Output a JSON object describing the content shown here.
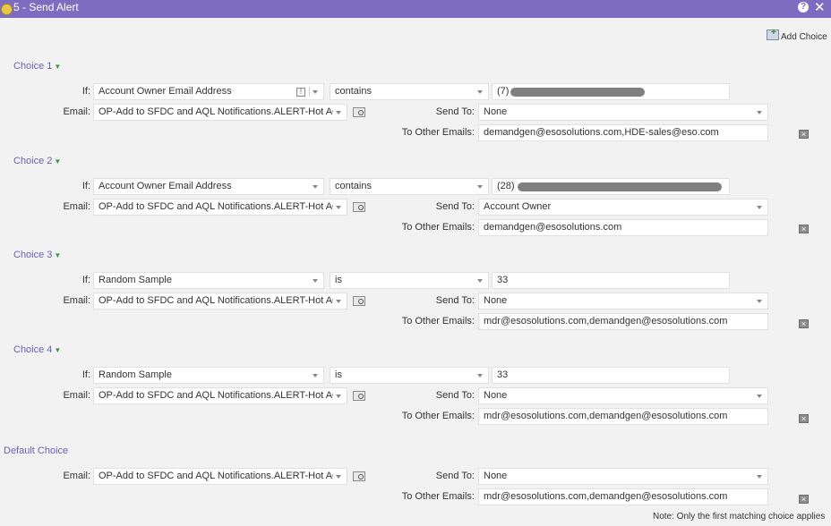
{
  "title": "5 - Send Alert",
  "add_choice_label": "Add Choice",
  "labels": {
    "if": "If:",
    "email": "Email:",
    "send_to": "Send To:",
    "to_other_emails": "To Other Emails:"
  },
  "choices": [
    {
      "title": "Choice 1",
      "if_field": "Account Owner Email Address",
      "operator": "contains",
      "value": "(7)",
      "value_redacted": true,
      "email": "OP-Add to SFDC and AQL Notifications.ALERT-Hot AQL",
      "send_to": "None",
      "to_other_emails": "demandgen@esosolutions.com,HDE-sales@eso.com"
    },
    {
      "title": "Choice 2",
      "if_field": "Account Owner Email Address",
      "operator": "contains",
      "value": "(28)",
      "value_redacted": true,
      "email": "OP-Add to SFDC and AQL Notifications.ALERT-Hot AQL",
      "send_to": "Account Owner",
      "to_other_emails": "demandgen@esosolutions.com"
    },
    {
      "title": "Choice 3",
      "if_field": "Random Sample",
      "operator": "is",
      "value": "33",
      "value_redacted": false,
      "email": "OP-Add to SFDC and AQL Notifications.ALERT-Hot AQL",
      "send_to": "None",
      "to_other_emails": "mdr@esosolutions.com,demandgen@esosolutions.com"
    },
    {
      "title": "Choice 4",
      "if_field": "Random Sample",
      "operator": "is",
      "value": "33",
      "value_redacted": false,
      "email": "OP-Add to SFDC and AQL Notifications.ALERT-Hot AQL",
      "send_to": "None",
      "to_other_emails": "mdr@esosolutions.com,demandgen@esosolutions.com"
    }
  ],
  "default_choice": {
    "title": "Default Choice",
    "email": "OP-Add to SFDC and AQL Notifications.ALERT-Hot AQL",
    "send_to": "None",
    "to_other_emails": "mdr@esosolutions.com,demandgen@esosolutions.com"
  },
  "note": "Note: Only the first matching choice applies",
  "colors": {
    "titlebar": "#7d6cc0",
    "choice_title": "#6b5fb5",
    "arrow": "#3e9c3e"
  }
}
